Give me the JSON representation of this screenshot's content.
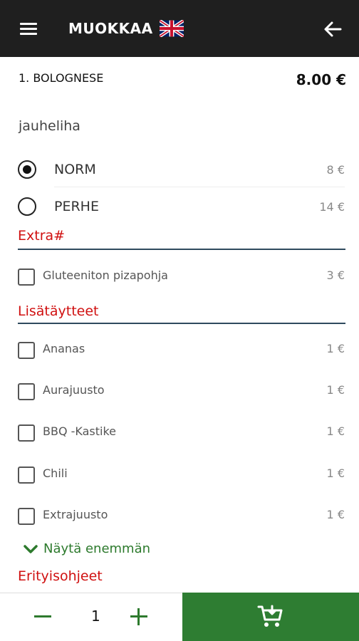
{
  "header": {
    "title": "MUOKKAA",
    "menu_icon": "hamburger-menu-icon",
    "language_flag": "uk-flag-icon",
    "back_icon": "arrow-left-icon"
  },
  "product": {
    "title": "1. BOLOGNESE",
    "price": "8.00 €",
    "description": "jauheliha"
  },
  "sizes": [
    {
      "label": "NORM",
      "price": "8 €",
      "selected": true
    },
    {
      "label": "PERHE",
      "price": "14 €",
      "selected": false
    }
  ],
  "sections": {
    "extra": {
      "title": "Extra#",
      "items": [
        {
          "label": "Gluteeniton pizapohja",
          "price": "3 €",
          "checked": false
        }
      ]
    },
    "toppings": {
      "title": "Lisätäytteet",
      "items": [
        {
          "label": "Ananas",
          "price": "1 €",
          "checked": false
        },
        {
          "label": "Aurajuusto",
          "price": "1 €",
          "checked": false
        },
        {
          "label": "BBQ -Kastike",
          "price": "1 €",
          "checked": false
        },
        {
          "label": "Chili",
          "price": "1 €",
          "checked": false
        },
        {
          "label": "Extrajuusto",
          "price": "1 €",
          "checked": false
        }
      ]
    },
    "show_more": "Näytä enemmän",
    "instructions_title": "Erityisohjeet"
  },
  "footer": {
    "quantity": "1",
    "add_to_cart_icon": "cart-add-icon"
  },
  "colors": {
    "header_bg": "#1f1f1f",
    "accent_green": "#2e7d32",
    "section_red": "#d01010",
    "divider": "#2f4a5e"
  }
}
